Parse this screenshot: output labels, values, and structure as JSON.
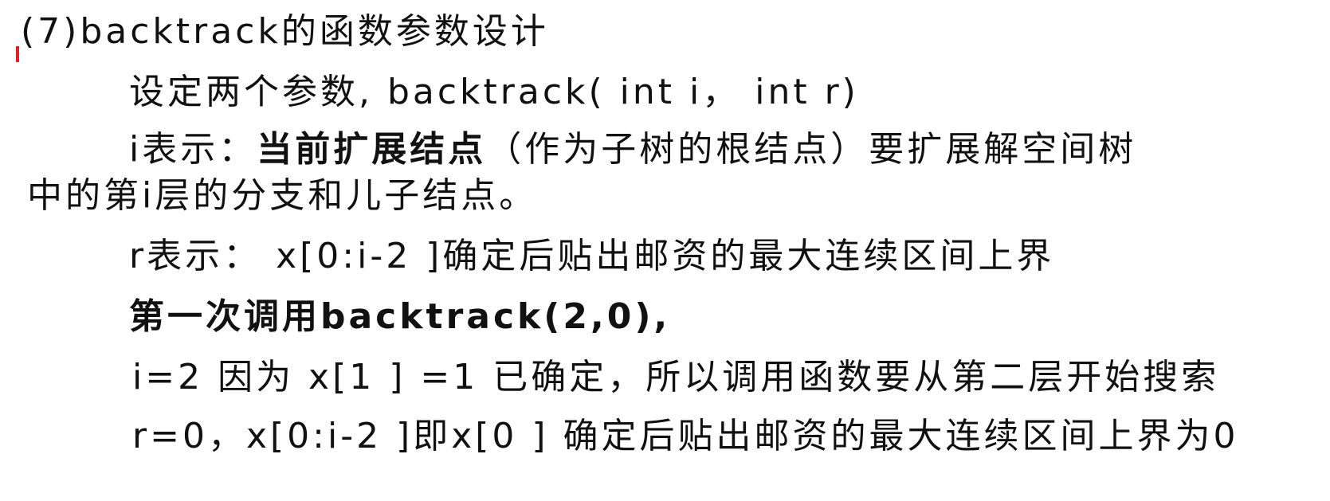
{
  "heading": "(7)backtrack的函数参数设计",
  "params_intro": "设定两个参数, backtrack( int  i， int r)",
  "i_desc": {
    "prefix": "i表示：",
    "emphasis": "当前扩展结点",
    "rest": "（作为子树的根结点）要扩展解空间树",
    "continuation": "中的第i层的分支和儿子结点。"
  },
  "r_desc": "r表示： x[0:i-2 ]确定后贴出邮资的最大连续区间上界",
  "first_call": "第一次调用backtrack(2,0),",
  "i_value": "i=2 因为 x[1 ] =1 已确定，所以调用函数要从第二层开始搜索",
  "r_value": "r=0，x[0:i-2 ]即x[0 ] 确定后贴出邮资的最大连续区间上界为0",
  "colors": {
    "text": "#111111",
    "marker": "#e02020"
  }
}
